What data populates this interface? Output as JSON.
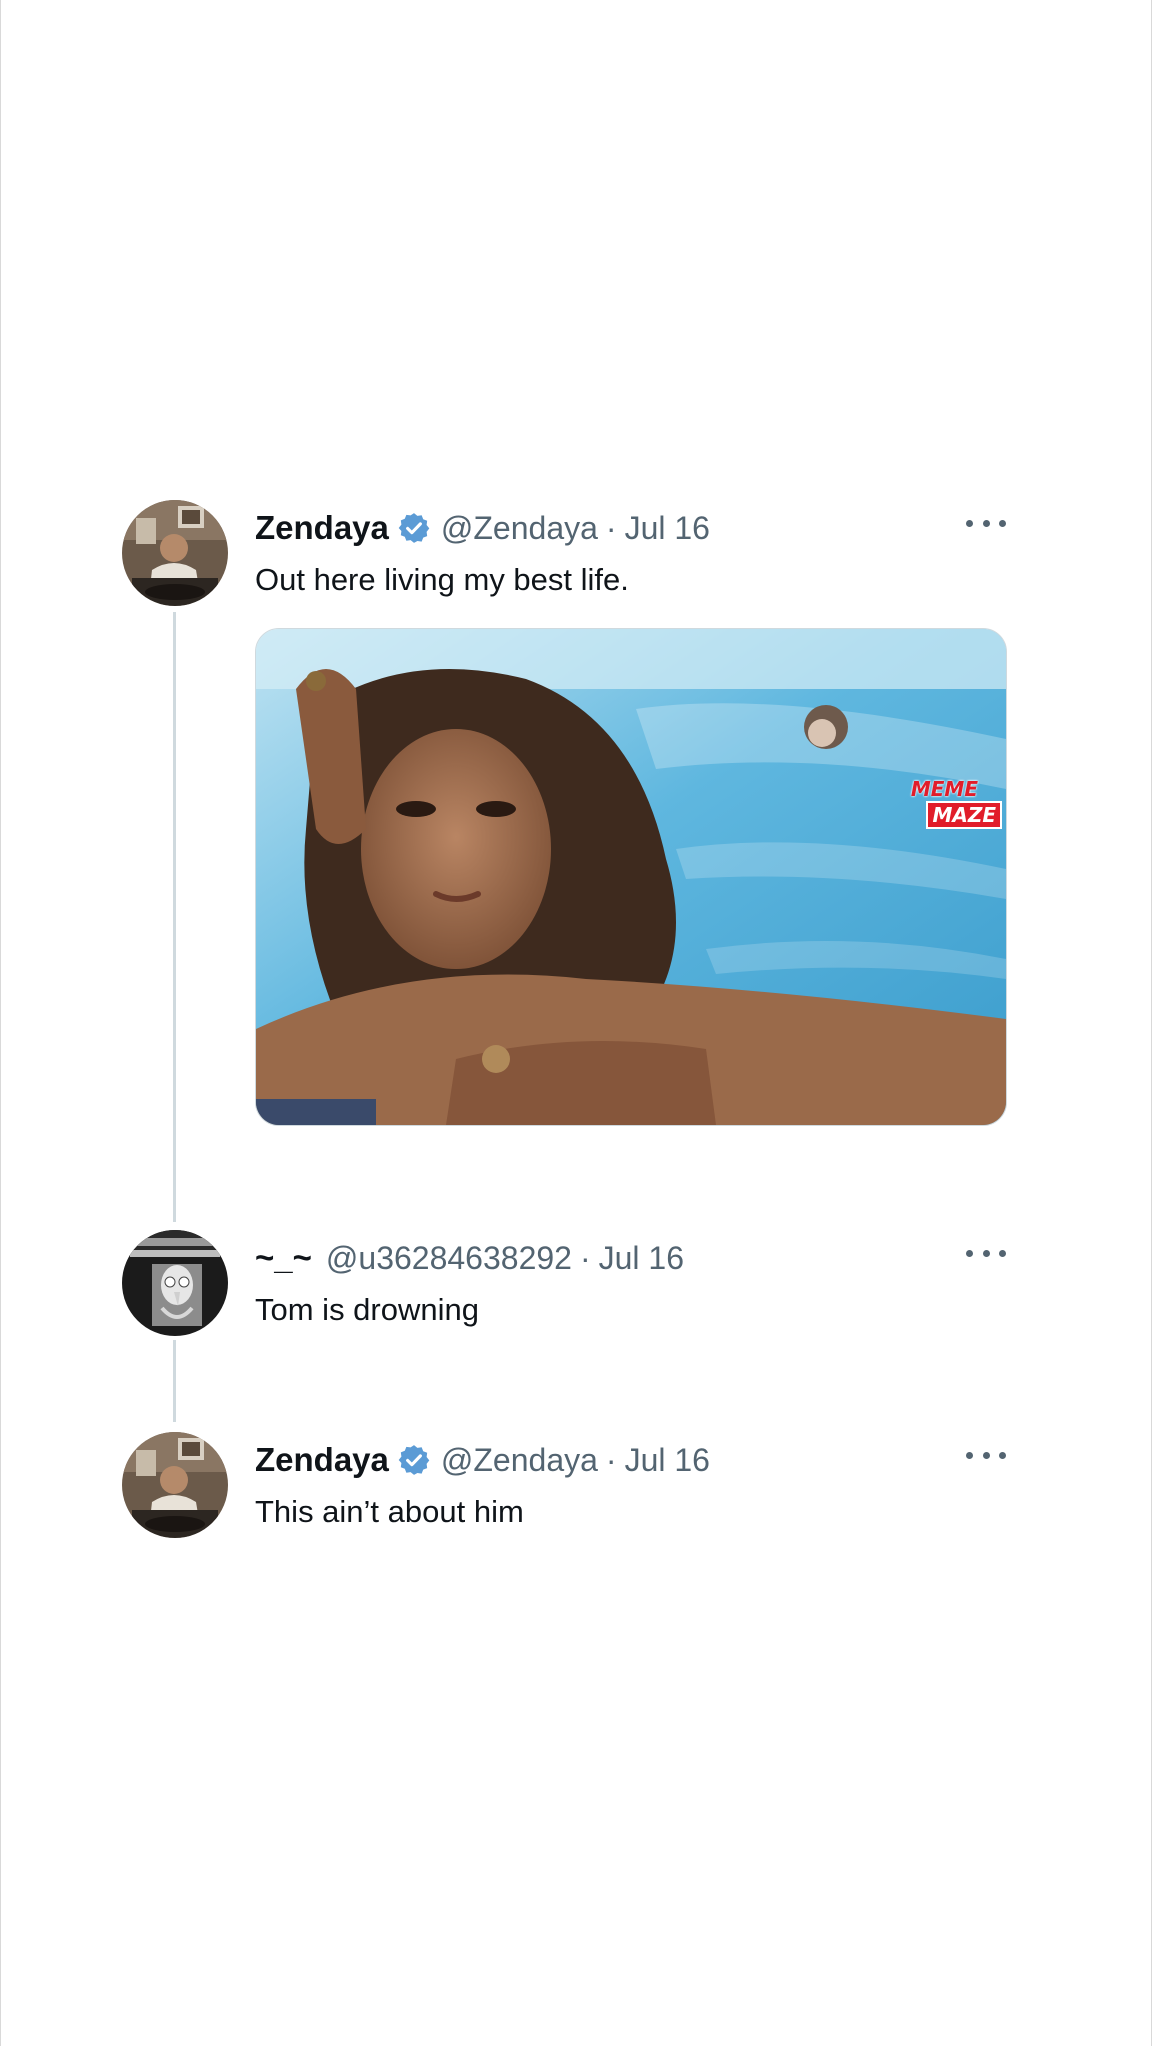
{
  "tweets": [
    {
      "display_name": "Zendaya",
      "verified": true,
      "handle": "@Zendaya",
      "separator": "·",
      "date": "Jul 16",
      "text": "Out here living my best life.",
      "media": {
        "watermark_line1": "MEME",
        "watermark_line2": "MAZE"
      }
    },
    {
      "display_name": "~_~",
      "verified": false,
      "handle": "@u36284638292",
      "separator": "·",
      "date": "Jul 16",
      "text": "Tom is drowning"
    },
    {
      "display_name": "Zendaya",
      "verified": true,
      "handle": "@Zendaya",
      "separator": "·",
      "date": "Jul 16",
      "text": "This ain’t about him"
    }
  ],
  "icons": {
    "verified": "verified-badge-icon",
    "more": "more-options-icon"
  },
  "colors": {
    "verified_blue": "#5b9bd5",
    "secondary_text": "#536471",
    "thread_line": "#cfd9de",
    "watermark_red": "#e11d2a"
  }
}
